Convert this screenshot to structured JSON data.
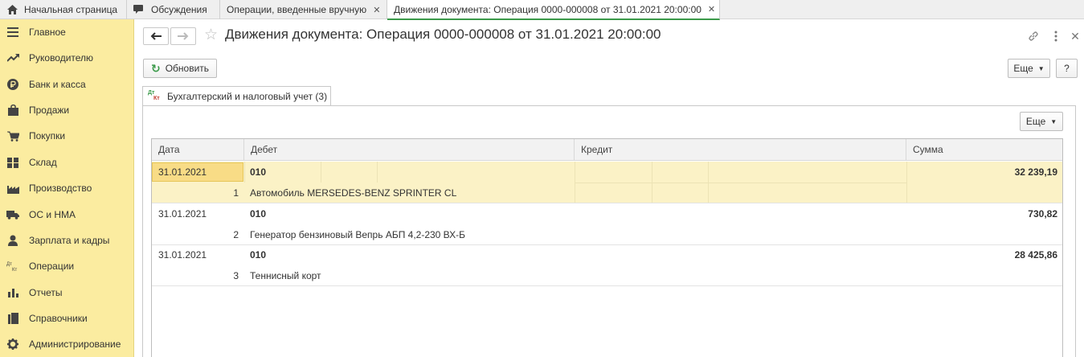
{
  "tabs": [
    {
      "label": "Начальная страница",
      "icon": "home-icon"
    },
    {
      "label": "Обсуждения",
      "icon": "chat-icon"
    },
    {
      "label": "Операции, введенные вручную",
      "icon": ""
    },
    {
      "label": "Движения документа: Операция 0000-000008 от 31.01.2021 20:00:00",
      "icon": ""
    }
  ],
  "sidebar": {
    "items": [
      {
        "label": "Главное",
        "icon": "menu-icon"
      },
      {
        "label": "Руководителю",
        "icon": "trend-icon"
      },
      {
        "label": "Банк и касса",
        "icon": "ruble-coin-icon"
      },
      {
        "label": "Продажи",
        "icon": "shopping-bag-icon"
      },
      {
        "label": "Покупки",
        "icon": "cart-icon"
      },
      {
        "label": "Склад",
        "icon": "warehouse-icon"
      },
      {
        "label": "Производство",
        "icon": "factory-icon"
      },
      {
        "label": "ОС и НМА",
        "icon": "truck-icon"
      },
      {
        "label": "Зарплата и кадры",
        "icon": "person-icon"
      },
      {
        "label": "Операции",
        "icon": "dt-kt-icon"
      },
      {
        "label": "Отчеты",
        "icon": "bar-chart-icon"
      },
      {
        "label": "Справочники",
        "icon": "books-icon"
      },
      {
        "label": "Администрирование",
        "icon": "gear-icon"
      }
    ]
  },
  "header": {
    "title": "Движения документа: Операция 0000-000008 от 31.01.2021 20:00:00"
  },
  "toolbar": {
    "refresh_label": "Обновить",
    "more_label": "Еще",
    "help_label": "?"
  },
  "section_tab": {
    "label": "Бухгалтерский и налоговый учет (3)",
    "icon_top": "Дт",
    "icon_bottom": "Кт"
  },
  "panel": {
    "more_label": "Еще"
  },
  "table": {
    "columns": [
      "Дата",
      "Дебет",
      "Кредит",
      "Сумма"
    ],
    "rows": [
      {
        "date": "31.01.2021",
        "n": "1",
        "debit_account": "010",
        "debit_subconto": "Автомобиль MERSEDES-BENZ SPRINTER CL",
        "amount": "32 239,19",
        "selected": true
      },
      {
        "date": "31.01.2021",
        "n": "2",
        "debit_account": "010",
        "debit_subconto": "Генератор бензиновый Вепрь АБП 4,2-230 ВХ-Б",
        "amount": "730,82",
        "selected": false
      },
      {
        "date": "31.01.2021",
        "n": "3",
        "debit_account": "010",
        "debit_subconto": "Теннисный корт",
        "amount": "28 425,86",
        "selected": false
      }
    ]
  },
  "colors": {
    "sidebar_bg": "#fbeca0",
    "selected_row": "#fbf2c6",
    "active_tab_accent": "#3b9a4a",
    "refresh_icon": "#3b9a4a"
  }
}
